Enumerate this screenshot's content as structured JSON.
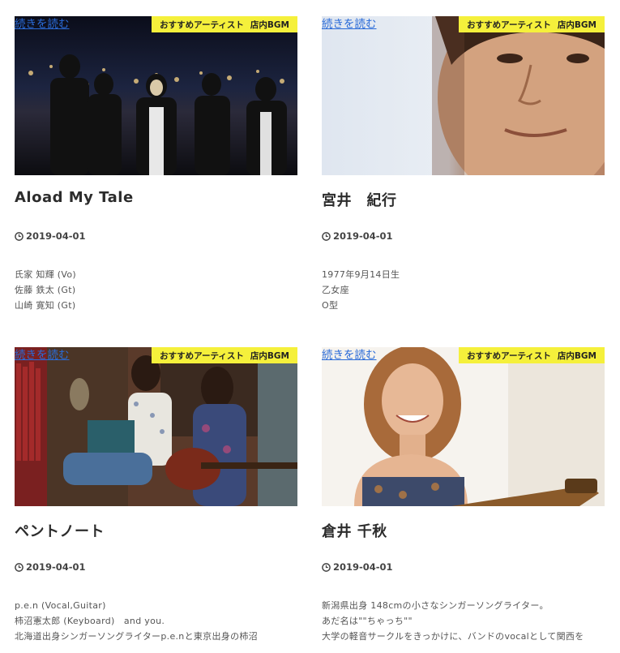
{
  "posts": [
    {
      "read_more": "続きを読む",
      "tags": [
        "おすすめアーティスト",
        "店内BGM"
      ],
      "title": "Aload My Tale",
      "date": "2019-04-01",
      "lines": [
        "氏家 知輝 (Vo)",
        "佐藤 鉄太 (Gt)",
        "山崎 寛知 (Gt)"
      ]
    },
    {
      "read_more": "続きを読む",
      "tags": [
        "おすすめアーティスト",
        "店内BGM"
      ],
      "title": "宮井　紀行",
      "date": "2019-04-01",
      "lines": [
        "1977年9月14日生",
        "乙女座",
        "O型"
      ]
    },
    {
      "read_more": "続きを読む",
      "tags": [
        "おすすめアーティスト",
        "店内BGM"
      ],
      "title": "ペントノート",
      "date": "2019-04-01",
      "lines": [
        "p.e.n (Vocal,Guitar)",
        "柿沼憲太郎 (Keyboard)　and you.",
        "北海道出身シンガーソングライターp.e.nと東京出身の柿沼"
      ]
    },
    {
      "read_more": "続きを読む",
      "tags": [
        "おすすめアーティスト",
        "店内BGM"
      ],
      "title": "倉井 千秋",
      "date": "2019-04-01",
      "lines": [
        "新潟県出身 148cmの小さなシンガーソングライター。",
        "あだ名は\"\"ちゃっち\"\"",
        "大学の軽音サークルをきっかけに、バンドのvocalとして関西を"
      ]
    }
  ],
  "icons": {
    "date": "clock-icon"
  },
  "colors": {
    "tag_bg": "#f5f03b",
    "link": "#2a6bd8"
  }
}
